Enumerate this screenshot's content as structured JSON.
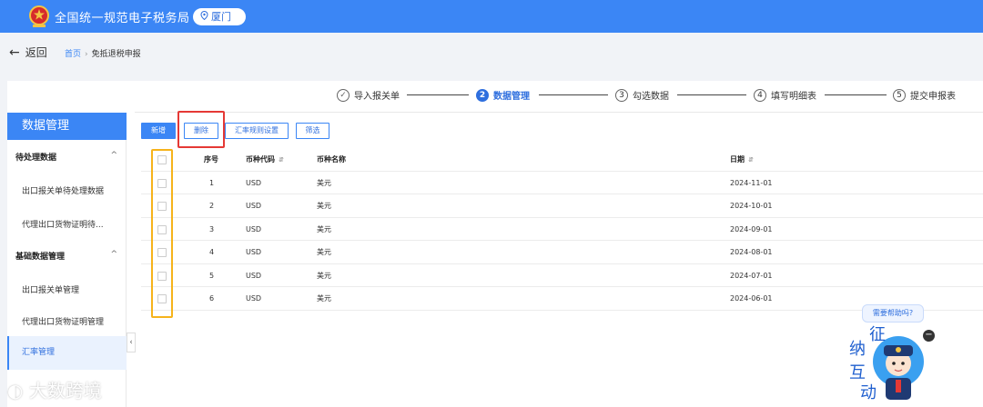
{
  "header": {
    "title": "全国统一规范电子税务局",
    "city": "厦门",
    "brand_color": "#3b86f5"
  },
  "subbar": {
    "back_label": "返回",
    "breadcrumb_home": "首页",
    "breadcrumb_current": "免抵退税申报"
  },
  "steps": [
    {
      "num": "✓",
      "label": "导入报关单",
      "state": "done"
    },
    {
      "num": "2",
      "label": "数据管理",
      "state": "active"
    },
    {
      "num": "3",
      "label": "勾选数据",
      "state": "todo"
    },
    {
      "num": "4",
      "label": "填写明细表",
      "state": "todo"
    },
    {
      "num": "5",
      "label": "提交申报表",
      "state": "todo"
    }
  ],
  "sidebar": {
    "title": "数据管理",
    "groups": [
      {
        "label": "待处理数据",
        "items": [
          "出口报关单待处理数据",
          "代理出口货物证明待..."
        ]
      },
      {
        "label": "基础数据管理",
        "items": [
          "出口报关单管理",
          "代理出口货物证明管理",
          "汇率管理"
        ]
      }
    ],
    "active_item": "汇率管理"
  },
  "toolbar": {
    "add_label": "新增",
    "delete_label": "删除",
    "rate_rule_label": "汇率规则设置",
    "filter_label": "筛选"
  },
  "table": {
    "columns": [
      "序号",
      "币种代码",
      "币种名称",
      "日期"
    ],
    "rows": [
      [
        "1",
        "USD",
        "美元",
        "2024-11-01"
      ],
      [
        "2",
        "USD",
        "美元",
        "2024-10-01"
      ],
      [
        "3",
        "USD",
        "美元",
        "2024-09-01"
      ],
      [
        "4",
        "USD",
        "美元",
        "2024-08-01"
      ],
      [
        "5",
        "USD",
        "美元",
        "2024-07-01"
      ],
      [
        "6",
        "USD",
        "美元",
        "2024-06-01"
      ]
    ]
  },
  "help": {
    "bubble": "需要帮助吗?",
    "mascot_chars": [
      "征",
      "纳",
      "互",
      "动"
    ]
  },
  "watermark": "大数跨境"
}
